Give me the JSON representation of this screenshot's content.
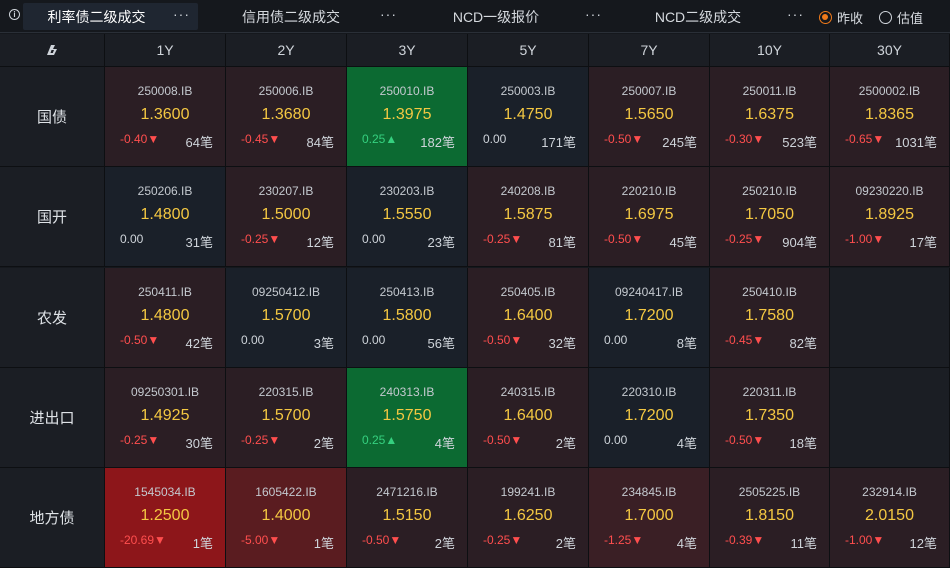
{
  "tabs": [
    {
      "label": "利率债二级成交",
      "more": "···",
      "active": true
    },
    {
      "label": "信用债二级成交",
      "more": "···",
      "active": false
    },
    {
      "label": "NCD一级报价",
      "more": "···",
      "active": false
    },
    {
      "label": "NCD二级成交",
      "more": "···",
      "active": false
    }
  ],
  "radios": [
    {
      "label": "昨收",
      "checked": true
    },
    {
      "label": "估值",
      "checked": false
    }
  ],
  "header": {
    "corner_icon": "logo-icon",
    "columns": [
      "1Y",
      "2Y",
      "3Y",
      "5Y",
      "7Y",
      "10Y",
      "30Y"
    ]
  },
  "rows": [
    {
      "label": "国债",
      "cells": [
        {
          "code": "250008.IB",
          "yield": "1.3600",
          "change": "-0.40",
          "dir": "down",
          "count": "64笔",
          "tone": "red1"
        },
        {
          "code": "250006.IB",
          "yield": "1.3680",
          "change": "-0.45",
          "dir": "down",
          "count": "84笔",
          "tone": "red1"
        },
        {
          "code": "250010.IB",
          "yield": "1.3975",
          "change": "0.25",
          "dir": "up",
          "count": "182笔",
          "tone": "green"
        },
        {
          "code": "250003.IB",
          "yield": "1.4750",
          "change": "0.00",
          "dir": "flat",
          "count": "171笔",
          "tone": "neutral"
        },
        {
          "code": "250007.IB",
          "yield": "1.5650",
          "change": "-0.50",
          "dir": "down",
          "count": "245笔",
          "tone": "red1"
        },
        {
          "code": "250011.IB",
          "yield": "1.6375",
          "change": "-0.30",
          "dir": "down",
          "count": "523笔",
          "tone": "red1"
        },
        {
          "code": "2500002.IB",
          "yield": "1.8365",
          "change": "-0.65",
          "dir": "down",
          "count": "1031笔",
          "tone": "red1"
        }
      ]
    },
    {
      "label": "国开",
      "cells": [
        {
          "code": "250206.IB",
          "yield": "1.4800",
          "change": "0.00",
          "dir": "flat",
          "count": "31笔",
          "tone": "neutral"
        },
        {
          "code": "230207.IB",
          "yield": "1.5000",
          "change": "-0.25",
          "dir": "down",
          "count": "12笔",
          "tone": "red1"
        },
        {
          "code": "230203.IB",
          "yield": "1.5550",
          "change": "0.00",
          "dir": "flat",
          "count": "23笔",
          "tone": "neutral"
        },
        {
          "code": "240208.IB",
          "yield": "1.5875",
          "change": "-0.25",
          "dir": "down",
          "count": "81笔",
          "tone": "red1"
        },
        {
          "code": "220210.IB",
          "yield": "1.6975",
          "change": "-0.50",
          "dir": "down",
          "count": "45笔",
          "tone": "red1"
        },
        {
          "code": "250210.IB",
          "yield": "1.7050",
          "change": "-0.25",
          "dir": "down",
          "count": "904笔",
          "tone": "red1"
        },
        {
          "code": "09230220.IB",
          "yield": "1.8925",
          "change": "-1.00",
          "dir": "down",
          "count": "17笔",
          "tone": "red1"
        }
      ]
    },
    {
      "label": "农发",
      "cells": [
        {
          "code": "250411.IB",
          "yield": "1.4800",
          "change": "-0.50",
          "dir": "down",
          "count": "42笔",
          "tone": "red1"
        },
        {
          "code": "09250412.IB",
          "yield": "1.5700",
          "change": "0.00",
          "dir": "flat",
          "count": "3笔",
          "tone": "neutral"
        },
        {
          "code": "250413.IB",
          "yield": "1.5800",
          "change": "0.00",
          "dir": "flat",
          "count": "56笔",
          "tone": "neutral"
        },
        {
          "code": "250405.IB",
          "yield": "1.6400",
          "change": "-0.50",
          "dir": "down",
          "count": "32笔",
          "tone": "red1"
        },
        {
          "code": "09240417.IB",
          "yield": "1.7200",
          "change": "0.00",
          "dir": "flat",
          "count": "8笔",
          "tone": "neutral"
        },
        {
          "code": "250410.IB",
          "yield": "1.7580",
          "change": "-0.45",
          "dir": "down",
          "count": "82笔",
          "tone": "red1"
        },
        null
      ]
    },
    {
      "label": "进出口",
      "cells": [
        {
          "code": "09250301.IB",
          "yield": "1.4925",
          "change": "-0.25",
          "dir": "down",
          "count": "30笔",
          "tone": "red1"
        },
        {
          "code": "220315.IB",
          "yield": "1.5700",
          "change": "-0.25",
          "dir": "down",
          "count": "2笔",
          "tone": "red1"
        },
        {
          "code": "240313.IB",
          "yield": "1.5750",
          "change": "0.25",
          "dir": "up",
          "count": "4笔",
          "tone": "green"
        },
        {
          "code": "240315.IB",
          "yield": "1.6400",
          "change": "-0.50",
          "dir": "down",
          "count": "2笔",
          "tone": "red1"
        },
        {
          "code": "220310.IB",
          "yield": "1.7200",
          "change": "0.00",
          "dir": "flat",
          "count": "4笔",
          "tone": "neutral"
        },
        {
          "code": "220311.IB",
          "yield": "1.7350",
          "change": "-0.50",
          "dir": "down",
          "count": "18笔",
          "tone": "red1"
        },
        null
      ]
    },
    {
      "label": "地方债",
      "cells": [
        {
          "code": "1545034.IB",
          "yield": "1.2500",
          "change": "-20.69",
          "dir": "down",
          "count": "1笔",
          "tone": "red3"
        },
        {
          "code": "1605422.IB",
          "yield": "1.4000",
          "change": "-5.00",
          "dir": "down",
          "count": "1笔",
          "tone": "red2"
        },
        {
          "code": "2471216.IB",
          "yield": "1.5150",
          "change": "-0.50",
          "dir": "down",
          "count": "2笔",
          "tone": "red1"
        },
        {
          "code": "199241.IB",
          "yield": "1.6250",
          "change": "-0.25",
          "dir": "down",
          "count": "2笔",
          "tone": "red1"
        },
        {
          "code": "234845.IB",
          "yield": "1.7000",
          "change": "-1.25",
          "dir": "down",
          "count": "4笔",
          "tone": "red1b"
        },
        {
          "code": "2505225.IB",
          "yield": "1.8150",
          "change": "-0.39",
          "dir": "down",
          "count": "11笔",
          "tone": "red1"
        },
        {
          "code": "232914.IB",
          "yield": "2.0150",
          "change": "-1.00",
          "dir": "down",
          "count": "12笔",
          "tone": "red1"
        }
      ]
    }
  ],
  "arrows": {
    "up": "▲",
    "down": "▼",
    "flat": ""
  },
  "colors": {
    "neutral": "#1a2029",
    "red1": "#2b1e24",
    "red1b": "#3a1f25",
    "red2": "#5a1c20",
    "red3": "#8d161a",
    "green": "#0c6a32",
    "empty": "#1b1e24",
    "yield": "#f4c842",
    "up": "#35d07f",
    "down": "#ff4e4e",
    "accent": "#f07a1a"
  }
}
